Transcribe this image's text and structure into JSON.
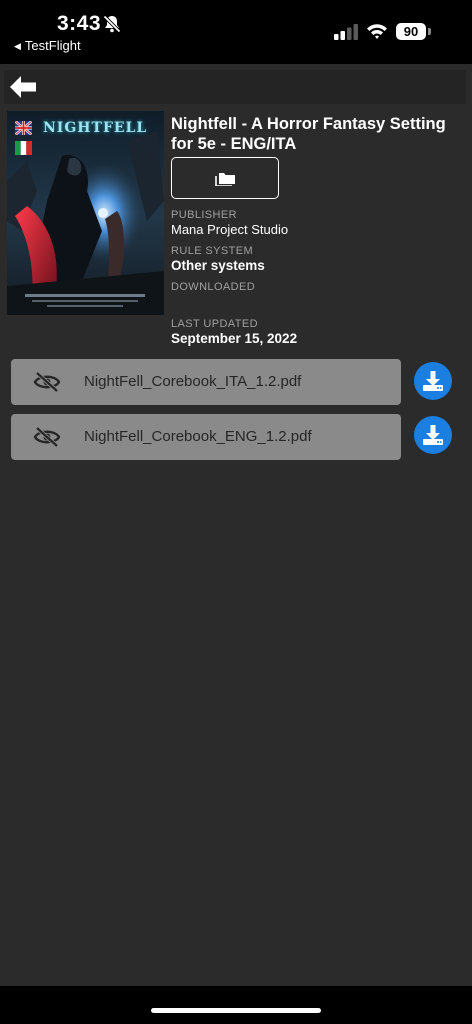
{
  "status_bar": {
    "time": "3:43",
    "back_app_label": "TestFlight",
    "battery": "90"
  },
  "book": {
    "title": "Nightfell - A Horror Fantasy Setting for 5e - ENG/ITA",
    "cover_logo_text": "NIGHTFELL",
    "publisher_label": "PUBLISHER",
    "publisher": "Mana Project Studio",
    "rule_system_label": "RULE SYSTEM",
    "rule_system": "Other systems",
    "downloaded_label": "DOWNLOADED",
    "last_updated_label": "LAST UPDATED",
    "last_updated": "September 15, 2022",
    "languages": [
      "en-flag-icon",
      "it-flag-icon"
    ]
  },
  "files": [
    {
      "name": "NightFell_Corebook_ITA_1.2.pdf"
    },
    {
      "name": "NightFell_Corebook_ENG_1.2.pdf"
    }
  ],
  "colors": {
    "background": "#2b2b2b",
    "file_row": "#8a8a8a",
    "download_accent": "#1a7fe0"
  }
}
